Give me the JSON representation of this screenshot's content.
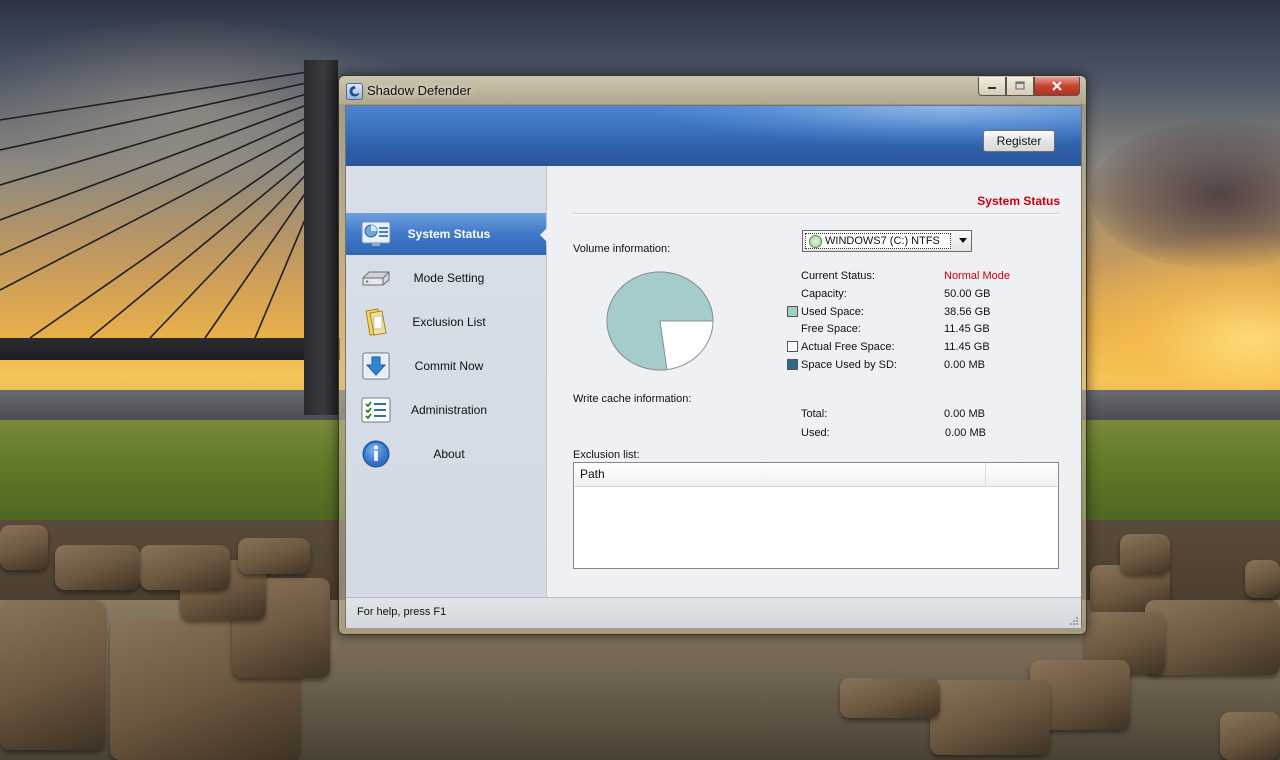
{
  "window": {
    "title": "Shadow Defender",
    "register_label": "Register"
  },
  "sidebar": {
    "items": [
      {
        "label": "System Status",
        "icon": "system-status-icon",
        "selected": true
      },
      {
        "label": "Mode Setting",
        "icon": "mode-setting-icon",
        "selected": false
      },
      {
        "label": "Exclusion List",
        "icon": "exclusion-list-icon",
        "selected": false
      },
      {
        "label": "Commit Now",
        "icon": "commit-now-icon",
        "selected": false
      },
      {
        "label": "Administration",
        "icon": "administration-icon",
        "selected": false
      },
      {
        "label": "About",
        "icon": "about-icon",
        "selected": false
      }
    ]
  },
  "main": {
    "section_title": "System Status",
    "volume_label": "Volume information:",
    "volume_select": "WINDOWS7 (C:) NTFS",
    "volume": {
      "current_status_label": "Current Status:",
      "current_status": "Normal Mode",
      "capacity_label": "Capacity:",
      "capacity": "50.00 GB",
      "used_label": "Used Space:",
      "used": "38.56 GB",
      "free_label": "Free Space:",
      "free": "11.45 GB",
      "actual_free_label": "Actual Free Space:",
      "actual_free": "11.45 GB",
      "sd_used_label": "Space Used by SD:",
      "sd_used": "0.00 MB"
    },
    "cache_label": "Write cache information:",
    "cache": {
      "total_label": "Total:",
      "total": "0.00 MB",
      "used_label": "Used:",
      "used": "0.00 MB"
    },
    "exclusion_label": "Exclusion list:",
    "exclusion_columns": [
      "Path"
    ]
  },
  "pie": {
    "used_fraction": 0.771,
    "used_color": "#a3cccb",
    "free_color": "#ffffff",
    "sd_color": "#2a6b88"
  },
  "statusbar": {
    "text": "For help, press F1"
  }
}
